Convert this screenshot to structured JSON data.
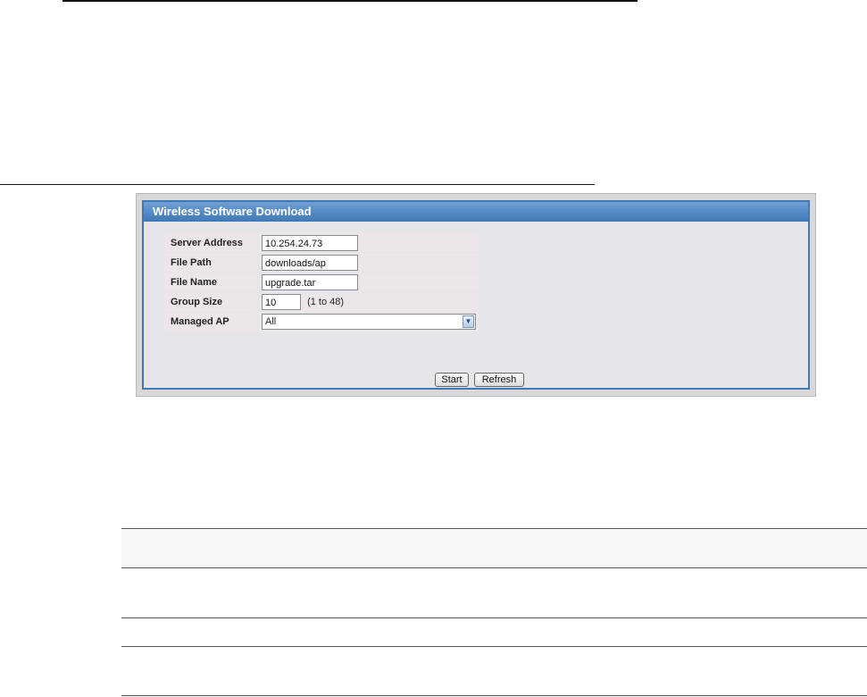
{
  "panel": {
    "title": "Wireless Software Download"
  },
  "form": {
    "server_address": {
      "label": "Server Address",
      "value": "10.254.24.73"
    },
    "file_path": {
      "label": "File Path",
      "value": "downloads/ap"
    },
    "file_name": {
      "label": "File Name",
      "value": "upgrade.tar"
    },
    "group_size": {
      "label": "Group Size",
      "value": "10",
      "hint": "(1 to 48)"
    },
    "managed_ap": {
      "label": "Managed AP",
      "value": "All"
    }
  },
  "buttons": {
    "start": "Start",
    "refresh": "Refresh"
  },
  "icons": {
    "dropdown": "chevron-down-icon"
  },
  "colors": {
    "header": "#3f79b6",
    "panel_bg": "#e5e5ea",
    "row_bg": "#ece6ea"
  }
}
